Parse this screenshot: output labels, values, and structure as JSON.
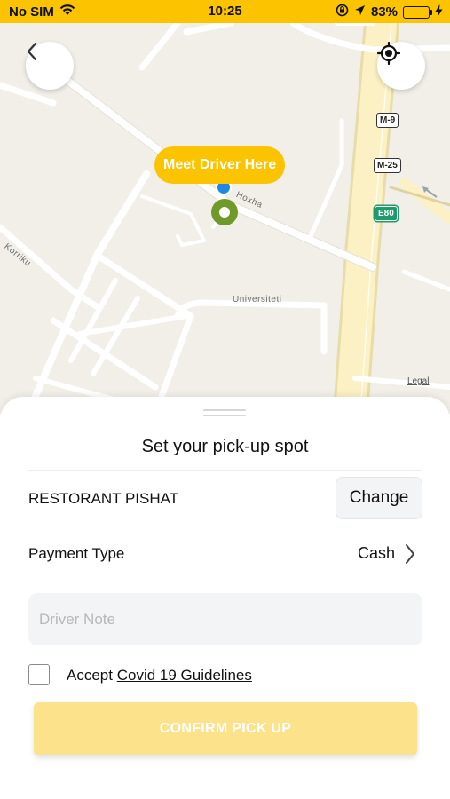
{
  "status_bar": {
    "carrier": "No SIM",
    "time": "10:25",
    "battery_percent": "83%",
    "battery_level": 0.83,
    "icons": [
      "wifi-icon",
      "orientation-lock-icon",
      "location-arrow-icon",
      "battery-icon",
      "charging-bolt-icon"
    ]
  },
  "map": {
    "pin_label": "Meet Driver Here",
    "road_labels": {
      "hoxha": "Hoxha",
      "korriku": "Korriku",
      "universiteti": "Universiteti"
    },
    "shields": {
      "m9": "M-9",
      "m25": "M-25",
      "e80": "E80"
    },
    "legal": "Legal",
    "colors": {
      "background": "#f2efe9",
      "road": "#ffffff",
      "highway": "#fbf1c4",
      "pin_green": "#6f9a2a",
      "pin_blue": "#1e88e5"
    }
  },
  "sheet": {
    "title": "Set your pick-up spot",
    "location": {
      "name": "RESTORANT PISHAT",
      "change_label": "Change"
    },
    "payment": {
      "label": "Payment Type",
      "value": "Cash"
    },
    "driver_note": {
      "value": "",
      "placeholder": "Driver Note"
    },
    "covid": {
      "checked": false,
      "prefix": "Accept",
      "link": "Covid 19 Guidelines"
    },
    "confirm_label": "CONFIRM PICK UP"
  },
  "colors": {
    "accent": "#fbc300",
    "confirm_disabled": "#fde28c"
  }
}
